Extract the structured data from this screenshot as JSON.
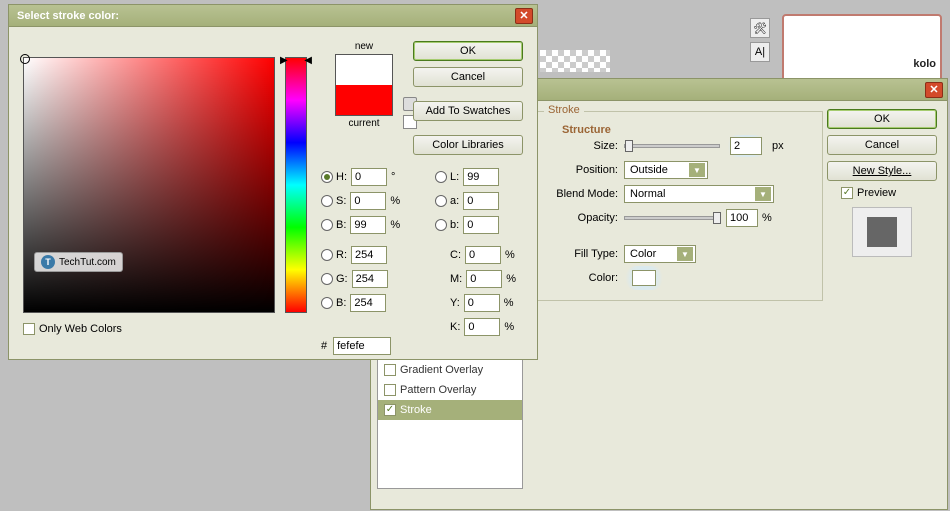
{
  "app": {
    "brand": "TechTut.com",
    "rpanel_text": "kolo",
    "tool_icons": [
      "✕",
      "A|"
    ]
  },
  "color_picker": {
    "title": "Select stroke color:",
    "new_label": "new",
    "current_label": "current",
    "only_web": "Only Web Colors",
    "hex_prefix": "#",
    "hex": "fefefe",
    "buttons": {
      "ok": "OK",
      "cancel": "Cancel",
      "add": "Add To Swatches",
      "libs": "Color Libraries"
    },
    "hsb_labels": {
      "H": "H:",
      "S": "S:",
      "B": "B:"
    },
    "hsb_vals": {
      "H": "0",
      "S": "0",
      "B": "99"
    },
    "hsb_units": {
      "H": "°",
      "S": "%",
      "B": "%"
    },
    "rgb_labels": {
      "R": "R:",
      "G": "G:",
      "B": "B:"
    },
    "rgb_vals": {
      "R": "254",
      "G": "254",
      "B": "254"
    },
    "lab_labels": {
      "L": "L:",
      "a": "a:",
      "b": "b:"
    },
    "lab_vals": {
      "L": "99",
      "a": "0",
      "b": "0"
    },
    "cmyk_labels": {
      "C": "C:",
      "M": "M:",
      "Y": "Y:",
      "K": "K:"
    },
    "cmyk_vals": {
      "C": "0",
      "M": "0",
      "Y": "0",
      "K": "0"
    },
    "pct": "%"
  },
  "layer_style": {
    "section_title": "Stroke",
    "structure_title": "Structure",
    "size_label": "Size:",
    "size_val": "2",
    "size_unit": "px",
    "position_label": "Position:",
    "position_val": "Outside",
    "blend_label": "Blend Mode:",
    "blend_val": "Normal",
    "opacity_label": "Opacity:",
    "opacity_val": "100",
    "pct": "%",
    "fill_label": "Fill Type:",
    "fill_val": "Color",
    "color_label": "Color:",
    "buttons": {
      "ok": "OK",
      "cancel": "Cancel",
      "newstyle": "New Style...",
      "preview": "Preview"
    },
    "list": {
      "grad": "Gradient Overlay",
      "pat": "Pattern Overlay",
      "stroke": "Stroke"
    }
  }
}
